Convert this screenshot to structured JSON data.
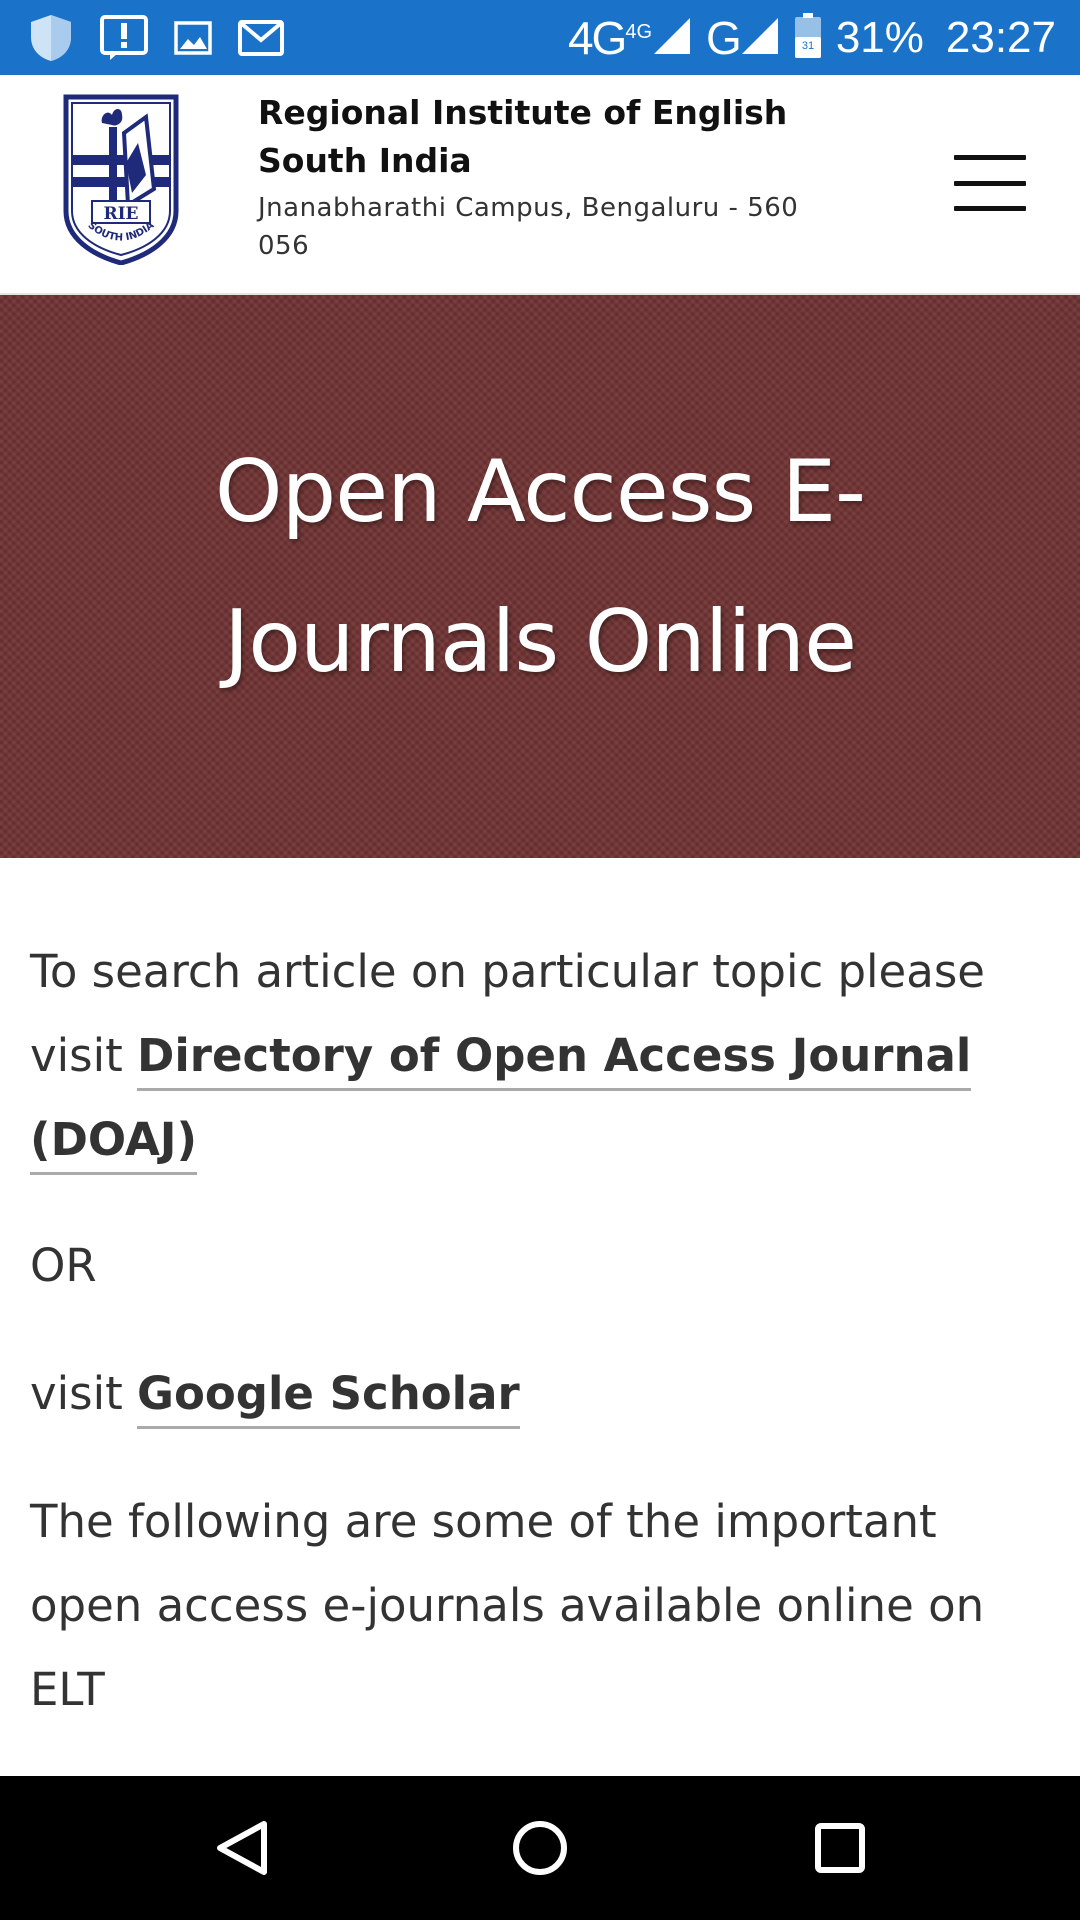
{
  "status_bar": {
    "network_primary": "4G",
    "network_sup": "4G",
    "network_secondary": "G",
    "battery_icon_text": "31",
    "battery_percent": "31%",
    "time": "23:27",
    "color": "#1a73c8",
    "icons": [
      "shield-icon",
      "alert-icon",
      "image-icon",
      "gmail-icon",
      "signal-icon",
      "battery-icon"
    ]
  },
  "header": {
    "logo_text_top": "RIE",
    "logo_text_bottom": "SOUTH INDIA",
    "title_line1": "Regional Institute of English",
    "title_line2": "South India",
    "address_line1": "Jnanabharathi Campus, Bengaluru - 560",
    "address_line2": "056",
    "menu_icon": "hamburger-icon"
  },
  "hero": {
    "title": "Open Access E-Journals Online",
    "background_color": "#6e3232"
  },
  "content": {
    "p1_text": "To search article on particular topic please visit ",
    "p1_link": "Directory of Open Access Journal (DOAJ)",
    "or_text": "OR",
    "p2_text": "visit ",
    "p2_link": "Google Scholar",
    "p3_text": "The following are some of the important open access e-journals available online on ELT"
  },
  "nav_bar": {
    "icons": [
      "back-icon",
      "home-icon",
      "recents-icon"
    ]
  }
}
